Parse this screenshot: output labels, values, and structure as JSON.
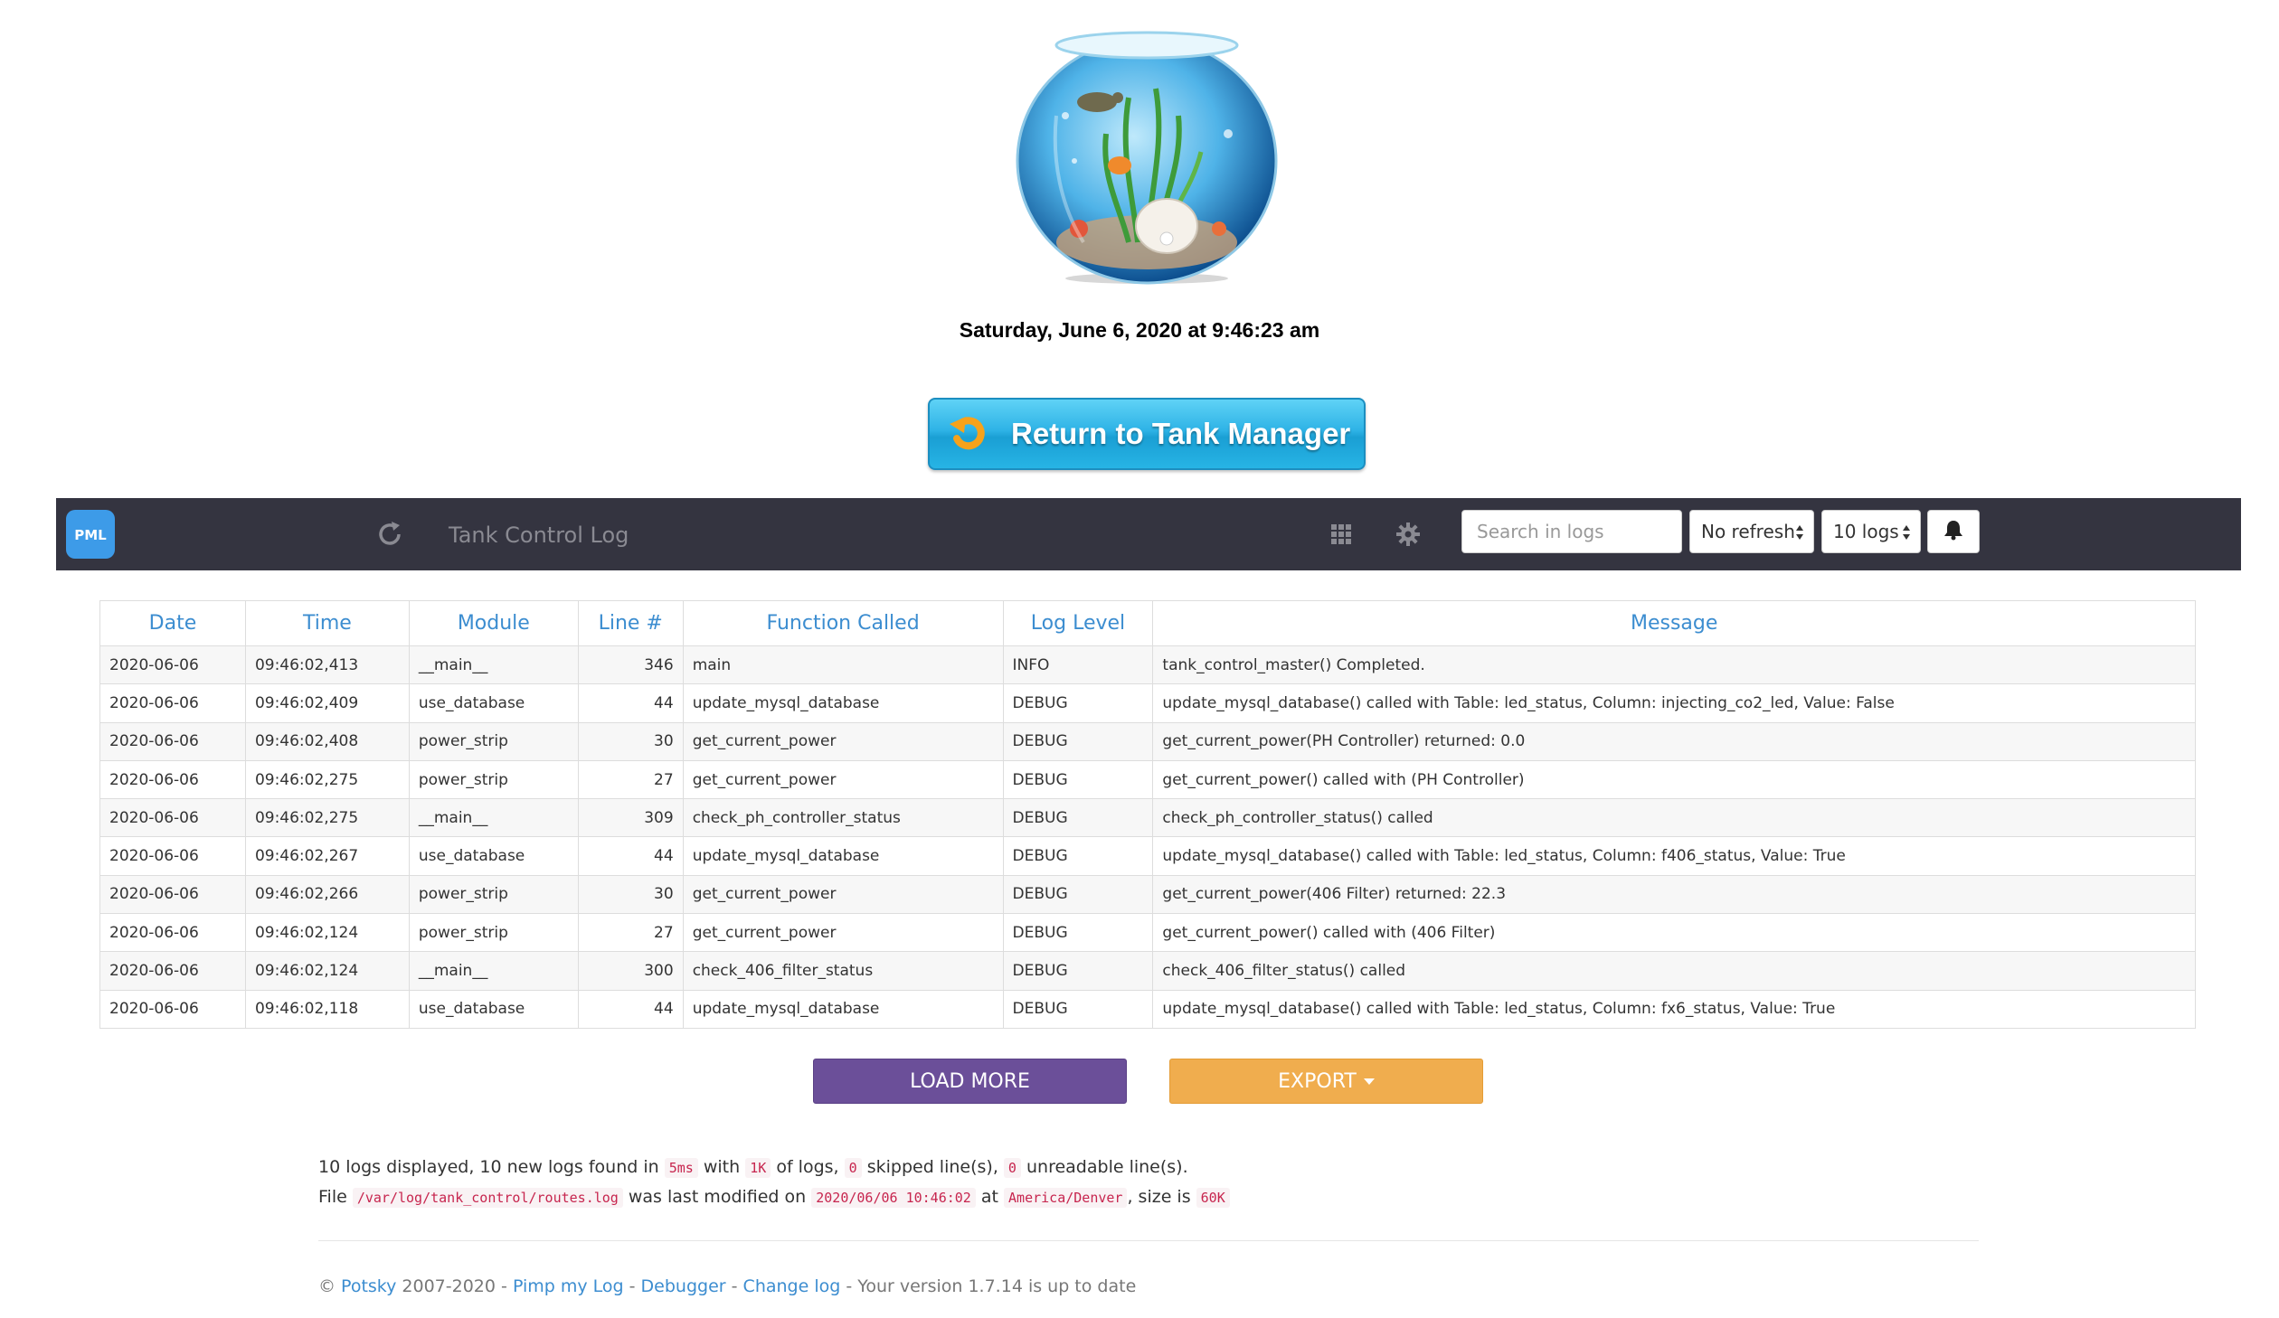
{
  "header": {
    "datetime": "Saturday, June 6, 2020 at 9:46:23 am",
    "return_button": "Return to Tank Manager"
  },
  "navbar": {
    "logo_text": "PML",
    "title": "Tank Control Log",
    "search_placeholder": "Search in logs",
    "refresh_select": "No refresh",
    "count_select": "10 logs",
    "icons": [
      "refresh-icon",
      "grid-icon",
      "gear-icon",
      "bell-icon"
    ]
  },
  "table": {
    "columns": [
      "Date",
      "Time",
      "Module",
      "Line #",
      "Function Called",
      "Log Level",
      "Message"
    ],
    "rows": [
      [
        "2020-06-06",
        "09:46:02,413",
        "__main__",
        "346",
        "main",
        "INFO",
        "tank_control_master() Completed."
      ],
      [
        "2020-06-06",
        "09:46:02,409",
        "use_database",
        "44",
        "update_mysql_database",
        "DEBUG",
        "update_mysql_database() called with Table: led_status, Column: injecting_co2_led, Value: False"
      ],
      [
        "2020-06-06",
        "09:46:02,408",
        "power_strip",
        "30",
        "get_current_power",
        "DEBUG",
        "get_current_power(PH Controller) returned: 0.0"
      ],
      [
        "2020-06-06",
        "09:46:02,275",
        "power_strip",
        "27",
        "get_current_power",
        "DEBUG",
        "get_current_power() called with (PH Controller)"
      ],
      [
        "2020-06-06",
        "09:46:02,275",
        "__main__",
        "309",
        "check_ph_controller_status",
        "DEBUG",
        "check_ph_controller_status() called"
      ],
      [
        "2020-06-06",
        "09:46:02,267",
        "use_database",
        "44",
        "update_mysql_database",
        "DEBUG",
        "update_mysql_database() called with Table: led_status, Column: f406_status, Value: True"
      ],
      [
        "2020-06-06",
        "09:46:02,266",
        "power_strip",
        "30",
        "get_current_power",
        "DEBUG",
        "get_current_power(406 Filter) returned: 22.3"
      ],
      [
        "2020-06-06",
        "09:46:02,124",
        "power_strip",
        "27",
        "get_current_power",
        "DEBUG",
        "get_current_power() called with (406 Filter)"
      ],
      [
        "2020-06-06",
        "09:46:02,124",
        "__main__",
        "300",
        "check_406_filter_status",
        "DEBUG",
        "check_406_filter_status() called"
      ],
      [
        "2020-06-06",
        "09:46:02,118",
        "use_database",
        "44",
        "update_mysql_database",
        "DEBUG",
        "update_mysql_database() called with Table: led_status, Column: fx6_status, Value: True"
      ]
    ]
  },
  "actions": {
    "load_more": "LOAD MORE",
    "export": "EXPORT"
  },
  "stats": {
    "t1": "10 logs displayed, 10 new logs found in",
    "duration": "5ms",
    "t2": "with",
    "size_of_logs": "1K",
    "t3": "of logs,",
    "skipped": "0",
    "t4": "skipped line(s),",
    "unreadable": "0",
    "t5": "unreadable line(s).",
    "t6": "File",
    "file_path": "/var/log/tank_control/routes.log",
    "t7": "was last modified on",
    "modified": "2020/06/06 10:46:02",
    "t8": "at",
    "timezone": "America/Denver",
    "t9": ", size is",
    "file_size": "60K"
  },
  "footer": {
    "copyright": "©",
    "author": "Potsky",
    "years": "2007-2020 -",
    "link1": "Pimp my Log",
    "sep1": "-",
    "link2": "Debugger",
    "sep2": " -",
    "link3": "Change log",
    "version_text": "- Your version 1.7.14 is up to date"
  }
}
